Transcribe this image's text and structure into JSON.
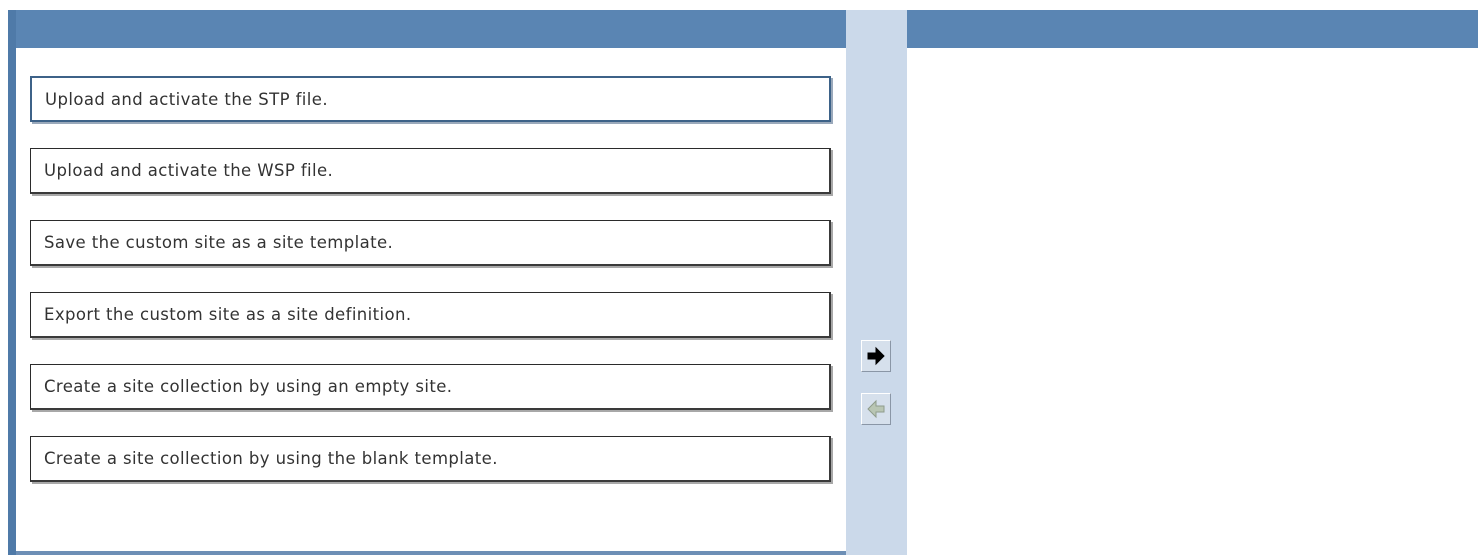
{
  "options": {
    "items": [
      {
        "label": "Upload and activate the STP file."
      },
      {
        "label": "Upload and activate the WSP file."
      },
      {
        "label": "Save the custom site as a site template."
      },
      {
        "label": "Export the custom site as a site definition."
      },
      {
        "label": "Create a site collection by using an empty site."
      },
      {
        "label": "Create a site collection by using the blank template."
      }
    ]
  },
  "controls": {
    "move_right": {
      "icon": "arrow-right-icon",
      "enabled": true
    },
    "move_left": {
      "icon": "arrow-left-icon",
      "enabled": false
    }
  },
  "answer_area": {
    "items": []
  },
  "colors": {
    "header_blue": "#5a85b3",
    "middle_strip": "#cbd9ea",
    "selected_border": "#3d6288"
  }
}
